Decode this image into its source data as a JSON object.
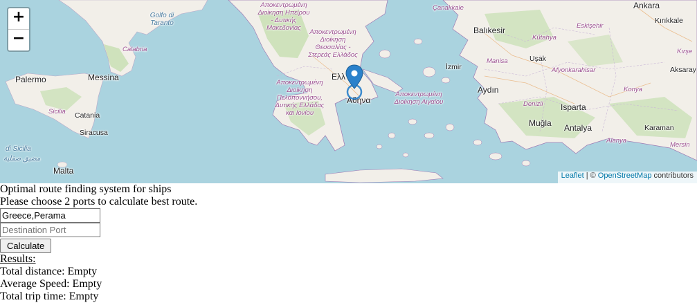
{
  "map": {
    "zoom_in": "+",
    "zoom_out": "−",
    "attribution": {
      "leaflet": "Leaflet",
      "sep": "| ©",
      "osm": "OpenStreetMap",
      "suffix": "contributors"
    },
    "marker_icon": "map-pin-icon",
    "colors": {
      "sea": "#aad3df",
      "land": "#f2efe9",
      "forest": "#c6dfb0",
      "border": "#9e7bb4",
      "marker": "#2a81cb"
    },
    "labels": {
      "cities": [
        "Palermo",
        "Messina",
        "Catania",
        "Siracusa",
        "Malta",
        "Balıkesir",
        "Aydın",
        "Muğla",
        "Antalya",
        "Isparta",
        "Ankara",
        "Kırıkkale",
        "Afyonkarahisar",
        "Uşak",
        "Manisa",
        "İzmir",
        "Kütahya",
        "Eskişehir",
        "Çanakkale",
        "Denizli",
        "Konya",
        "Karaman",
        "Aksaray",
        "Alanya",
        "Kırşe",
        "Mersin",
        "Αθήνα",
        "Ελλ"
      ],
      "regions": [
        "Αποκεντρωμένη Διοίκηση Ηπείρου - Δυτικής Μακεδονίας",
        "Αποκεντρωμένη Διοίκηση Θεσσαλίας - Στερεάς Ελλάδος",
        "Αποκεντρωμένη Διοίκηση Πελοποννήσου, Δυτικής Ελλάδας και Ιονίου",
        "Αποκεντρωμένη Διοίκηση Αιγαίου",
        "Sicilia",
        "Calabria",
        "Golfo di Taranto",
        "di Sicilia",
        "مضيق صقلية",
        "Balıkesir",
        "Kütahya"
      ]
    }
  },
  "page": {
    "title": "Optimal route finding system for ships",
    "instructions": "Please choose 2 ports to calculate best route.",
    "origin": {
      "value": "Greece,Perama",
      "placeholder": ""
    },
    "destination": {
      "value": "",
      "placeholder": "Destination Port"
    },
    "calculate_label": "Calculate",
    "results_heading": "Results:",
    "total_distance": "Total distance: Empty",
    "average_speed": "Average Speed: Empty",
    "total_trip_time": "Total trip time: Empty"
  }
}
